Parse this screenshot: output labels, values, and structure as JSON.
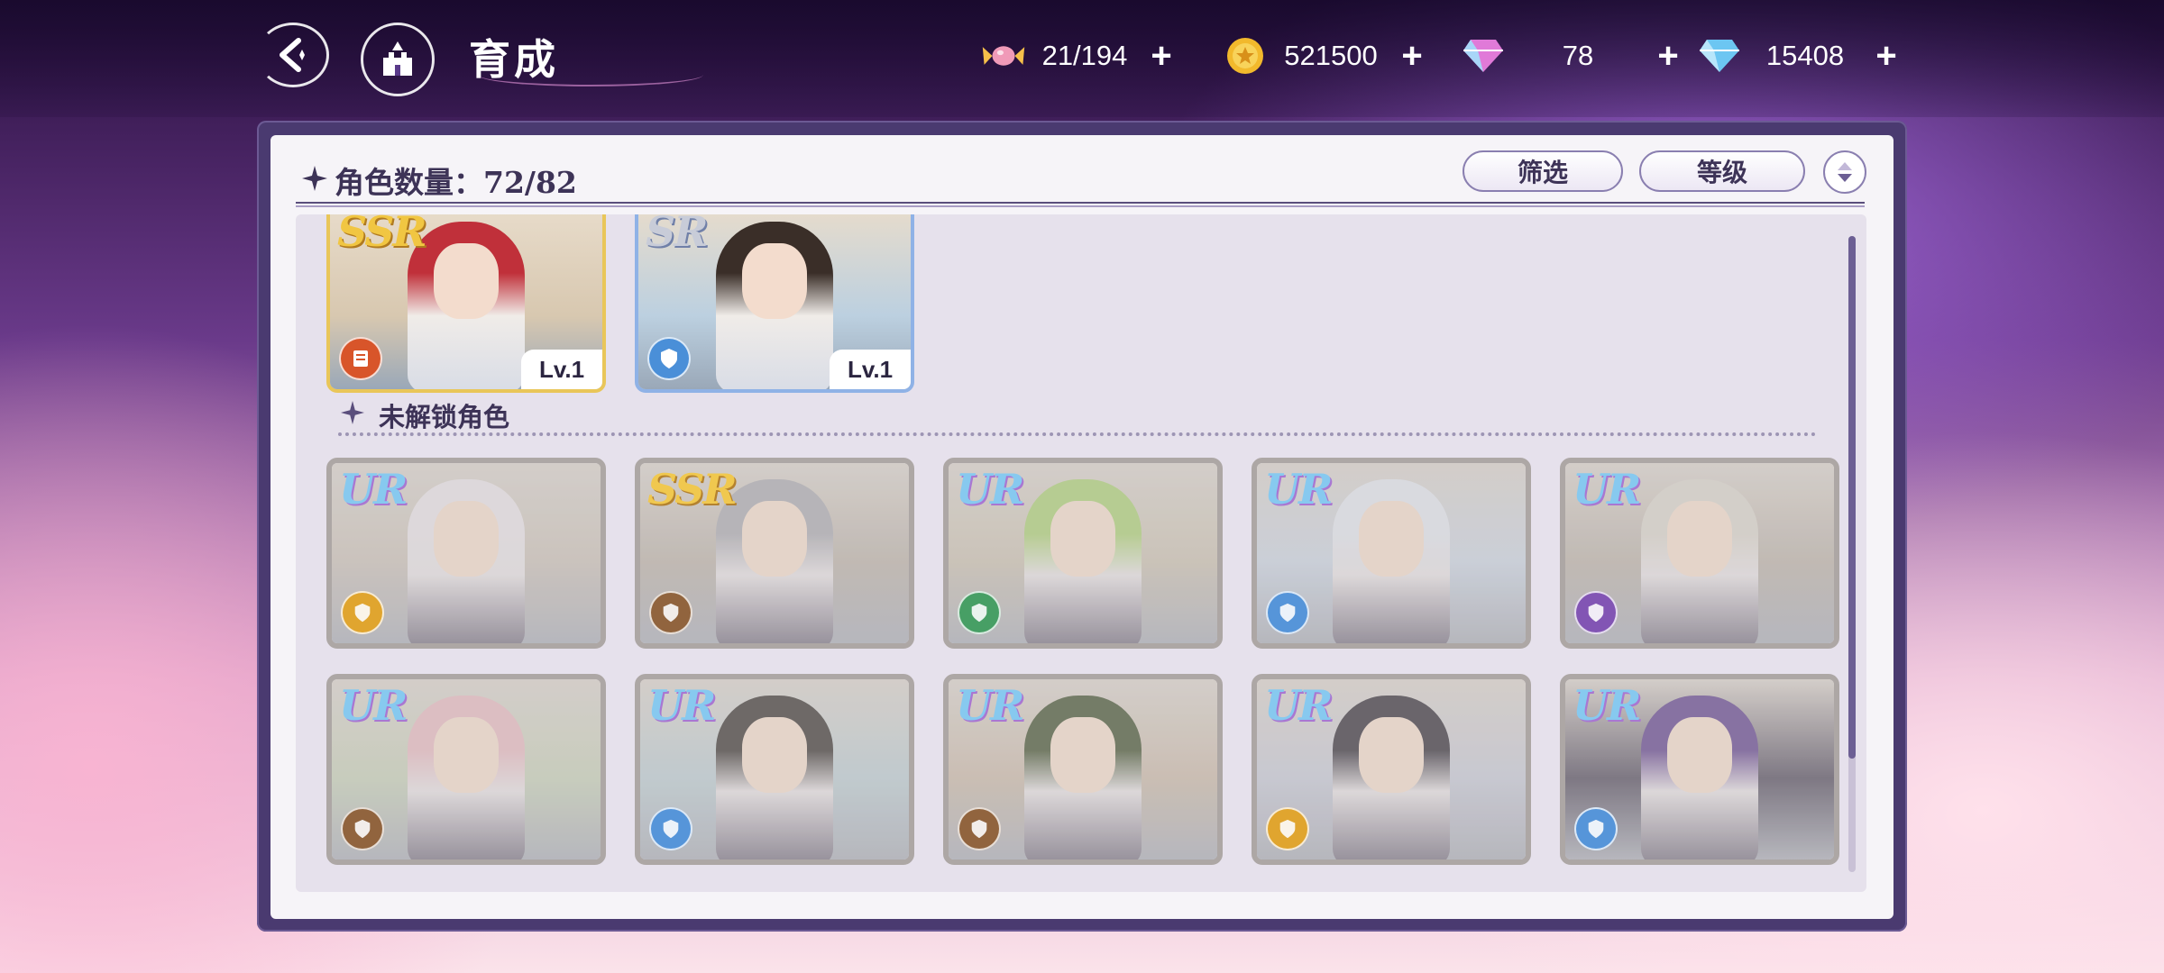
{
  "header": {
    "title": "育成",
    "currencies": [
      {
        "icon": "candy-icon",
        "value": "21/194"
      },
      {
        "icon": "gold-coin-icon",
        "value": "521500"
      },
      {
        "icon": "pink-gem-icon",
        "value": "78"
      },
      {
        "icon": "blue-diamond-icon",
        "value": "15408"
      }
    ]
  },
  "panel": {
    "count_label": "角色数量：72/82",
    "filter_label": "筛选",
    "sort_label": "等级"
  },
  "owned_cards": [
    {
      "rarity": "SSR",
      "level": "Lv.1",
      "role_color": "#d8552a",
      "hair": "#c0303a",
      "bg": "#d8c8b0"
    },
    {
      "rarity": "SR",
      "level": "Lv.1",
      "role_color": "#4a8fd8",
      "hair": "#3a2e28",
      "bg": "#bcd0e0"
    }
  ],
  "locked_section_label": "未解锁角色",
  "locked_cards": [
    {
      "rarity": "UR",
      "role_color": "#e0a020",
      "hair": "#e8e4ea",
      "bg": "#c8c0b8"
    },
    {
      "rarity": "SSR",
      "role_color": "#8a5a30",
      "hair": "#a8a8b0",
      "bg": "#b8b0a8"
    },
    {
      "rarity": "UR",
      "role_color": "#3a9a5a",
      "hair": "#a8d070",
      "bg": "#c8c0b0"
    },
    {
      "rarity": "UR",
      "role_color": "#4a8fd8",
      "hair": "#e0e6f0",
      "bg": "#c8d4e4"
    },
    {
      "rarity": "UR",
      "role_color": "#7a4ab0",
      "hair": "#d8d4cc",
      "bg": "#b8b0a8"
    },
    {
      "rarity": "UR",
      "role_color": "#8a5a30",
      "hair": "#e6b8c0",
      "bg": "#c4d0b8"
    },
    {
      "rarity": "UR",
      "role_color": "#4a8fd8",
      "hair": "#2e2a28",
      "bg": "#b8ccd4"
    },
    {
      "rarity": "UR",
      "role_color": "#8a5a30",
      "hair": "#3a4a28",
      "bg": "#c8b8a8"
    },
    {
      "rarity": "UR",
      "role_color": "#e0a020",
      "hair": "#282430",
      "bg": "#c4c8d8"
    },
    {
      "rarity": "UR",
      "role_color": "#4a8fd8",
      "hair": "#5a3a8a",
      "bg": "#4a4458"
    }
  ]
}
